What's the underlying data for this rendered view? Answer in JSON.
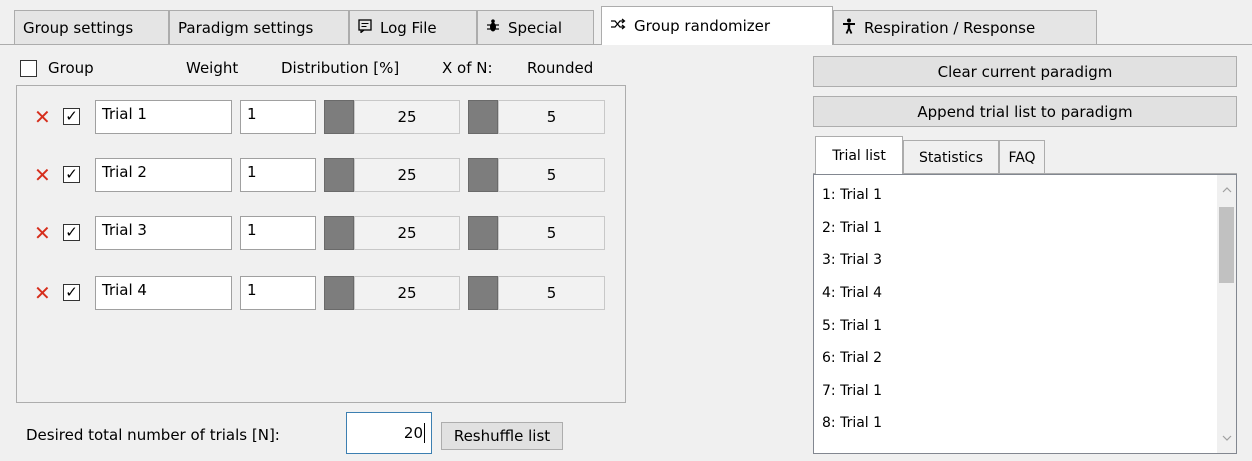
{
  "tabs": [
    {
      "label": "Group settings",
      "icon": ""
    },
    {
      "label": "Paradigm settings",
      "icon": ""
    },
    {
      "label": "Log File",
      "icon": "log-icon"
    },
    {
      "label": "Special",
      "icon": "bug-icon"
    },
    {
      "label": "Group randomizer",
      "icon": "shuffle-icon"
    },
    {
      "label": "Respiration / Response",
      "icon": "person-icon"
    }
  ],
  "active_tab": "Group randomizer",
  "left": {
    "header": {
      "group": "Group",
      "weight": "Weight",
      "distribution": "Distribution [%]",
      "x_of_n": "X of N:",
      "rounded": "Rounded"
    },
    "rows": [
      {
        "name": "Trial 1",
        "weight": "1",
        "distribution": "25",
        "rounded": "5",
        "checked": true
      },
      {
        "name": "Trial 2",
        "weight": "1",
        "distribution": "25",
        "rounded": "5",
        "checked": true
      },
      {
        "name": "Trial 3",
        "weight": "1",
        "distribution": "25",
        "rounded": "5",
        "checked": true
      },
      {
        "name": "Trial 4",
        "weight": "1",
        "distribution": "25",
        "rounded": "5",
        "checked": true
      }
    ],
    "total_label": "Desired total number of trials [N]:",
    "total_value": "20",
    "reshuffle_label": "Reshuffle list"
  },
  "right": {
    "clear_label": "Clear current paradigm",
    "append_label": "Append trial list to paradigm",
    "subtabs": [
      "Trial list",
      "Statistics",
      "FAQ"
    ],
    "trial_list": [
      "1: Trial 1",
      "2: Trial 1",
      "3: Trial 3",
      "4: Trial 4",
      "5: Trial 1",
      "6: Trial 2",
      "7: Trial 1",
      "8: Trial 1"
    ]
  },
  "colors": {
    "delete": "#d62e1c",
    "swatch": "#7d7d7d"
  }
}
